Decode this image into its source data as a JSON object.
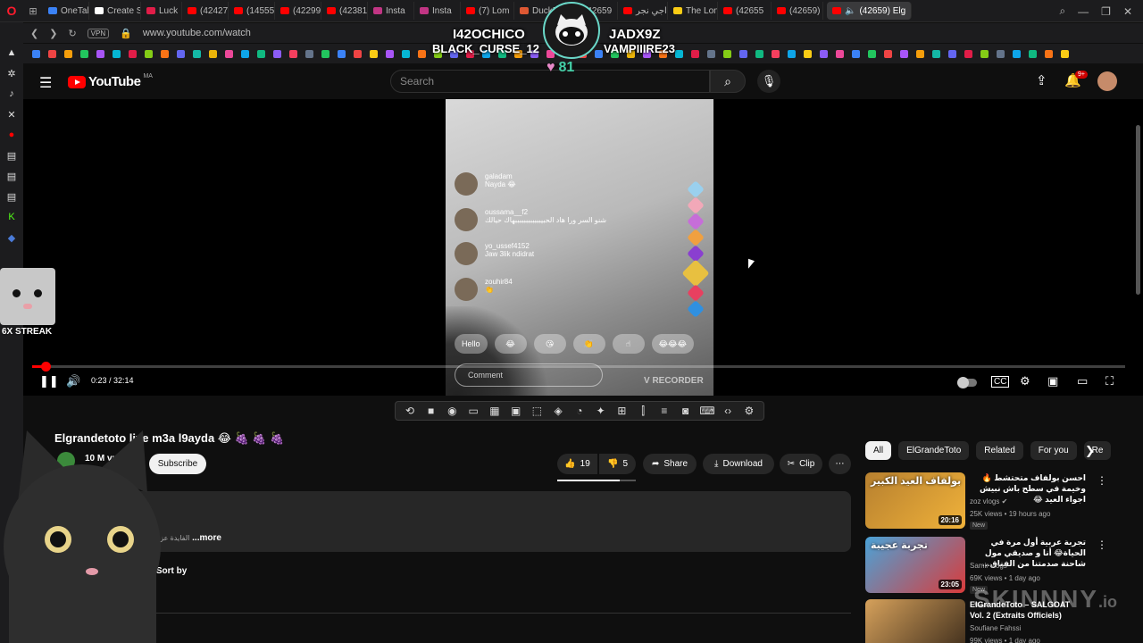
{
  "browser": {
    "tabs": [
      {
        "label": "OneTab",
        "color": "#3b82f6"
      },
      {
        "label": "Create S",
        "color": "#ffffff"
      },
      {
        "label": "Luck",
        "color": "#e11d48"
      },
      {
        "label": "(42427",
        "color": "#ff0000"
      },
      {
        "label": "(14555)",
        "color": "#ff0000"
      },
      {
        "label": "(42299",
        "color": "#ff0000"
      },
      {
        "label": "(42381)",
        "color": "#ff0000"
      },
      {
        "label": "Insta",
        "color": "#c13584"
      },
      {
        "label": "Insta",
        "color": "#c13584"
      },
      {
        "label": "(7) Lom",
        "color": "#ff0000"
      },
      {
        "label": "DuckDu",
        "color": "#de5833"
      },
      {
        "label": "(42659",
        "color": "#ff0000"
      },
      {
        "label": "اجي نجر",
        "color": "#ff0000"
      },
      {
        "label": "The Lon",
        "color": "#facc15"
      },
      {
        "label": "(42655",
        "color": "#ff0000"
      },
      {
        "label": "(42659)",
        "color": "#ff0000"
      }
    ],
    "active_tab": "(42659) Elg",
    "url": "www.youtube.com/watch",
    "vpn_label": "VPN"
  },
  "stream_overlay": {
    "name_left": "I42OCHICO",
    "name_right": "JADX9Z",
    "sub_left": "BLACK_CURSE_12",
    "sub_right": "VAMPIIIRE23",
    "hearts_count": "81"
  },
  "header": {
    "logo_text": "YouTube",
    "region": "MA",
    "search_placeholder": "Search",
    "notifications": "9+"
  },
  "video": {
    "live_comments": [
      {
        "user": "galadam",
        "text": "Nayda 😂"
      },
      {
        "user": "oussama__f2",
        "text": "شنو السر ورا هاد الحبيببببببببببببهاك حيالك"
      },
      {
        "user": "yo_ussef4152",
        "text": "Jaw 3lik ndidrat"
      },
      {
        "user": "zouhir84",
        "text": "👏"
      }
    ],
    "chips": [
      "Hello",
      "😂",
      "😘",
      "👏",
      "☝",
      "😂😂😂"
    ],
    "comment_placeholder": "Comment",
    "recorder_label": "V RECORDER",
    "time": "0:23 / 32:14",
    "progress": 0.012
  },
  "below_video": {
    "title": "Elgrandetoto live m3a l9ayda 😂 🍇 🍇 🍇",
    "channel_subs": "10 M vue",
    "subscribe_label": "Subscribe",
    "likes": "19",
    "dislikes": "5",
    "share_label": "Share",
    "download_label": "Download",
    "clip_label": "Clip",
    "more_label": "...more",
    "desc_snippet": "الفايدة عزة",
    "sort_label": "Sort by",
    "like_ratio": 0.79
  },
  "sidebar_filters": [
    "All",
    "ElGrandeToto",
    "Related",
    "For you",
    "Re"
  ],
  "recommendations": [
    {
      "title": "احسن بولفاف متحتشط 🔥 وخيمة في سطح باش نبيش اجواء العيد 😂",
      "channel": "zoz vlogs ✔",
      "meta": "25K views • 19 hours ago",
      "badge": "New",
      "duration": "20:16",
      "thumb_text": "بولفاف العيد الكبير",
      "thumb_colors": [
        "#b7802f",
        "#f0b23a"
      ],
      "rtl": true
    },
    {
      "title": "تجربة عربية أول مرة في الحياة😂 أنا و صديقي مول شاحنة صدمتنا من الفناق…",
      "channel": "Samir vlogs",
      "meta": "69K views • 1 day ago",
      "badge": "New",
      "duration": "23:05",
      "thumb_text": "تجربة عجيبة",
      "thumb_colors": [
        "#4aa3d8",
        "#d93b3b"
      ],
      "rtl": true
    },
    {
      "title": "ElGrandeToto – SALGOAT Vol. 2 (Extraits Officiels)",
      "channel": "Soufiane Fahssi",
      "meta": "99K views • 1 day ago",
      "badge": "",
      "duration": "",
      "thumb_text": "",
      "thumb_colors": [
        "#d6a15b",
        "#3a2a1a"
      ],
      "rtl": false
    }
  ],
  "overlays": {
    "streak_label": "6X STREAK",
    "watermark": "SKINNNY",
    "watermark_suffix": ".io"
  },
  "colors": {
    "accent": "#ff0000",
    "background": "#0f0f0f",
    "chip_bg": "#272727"
  }
}
